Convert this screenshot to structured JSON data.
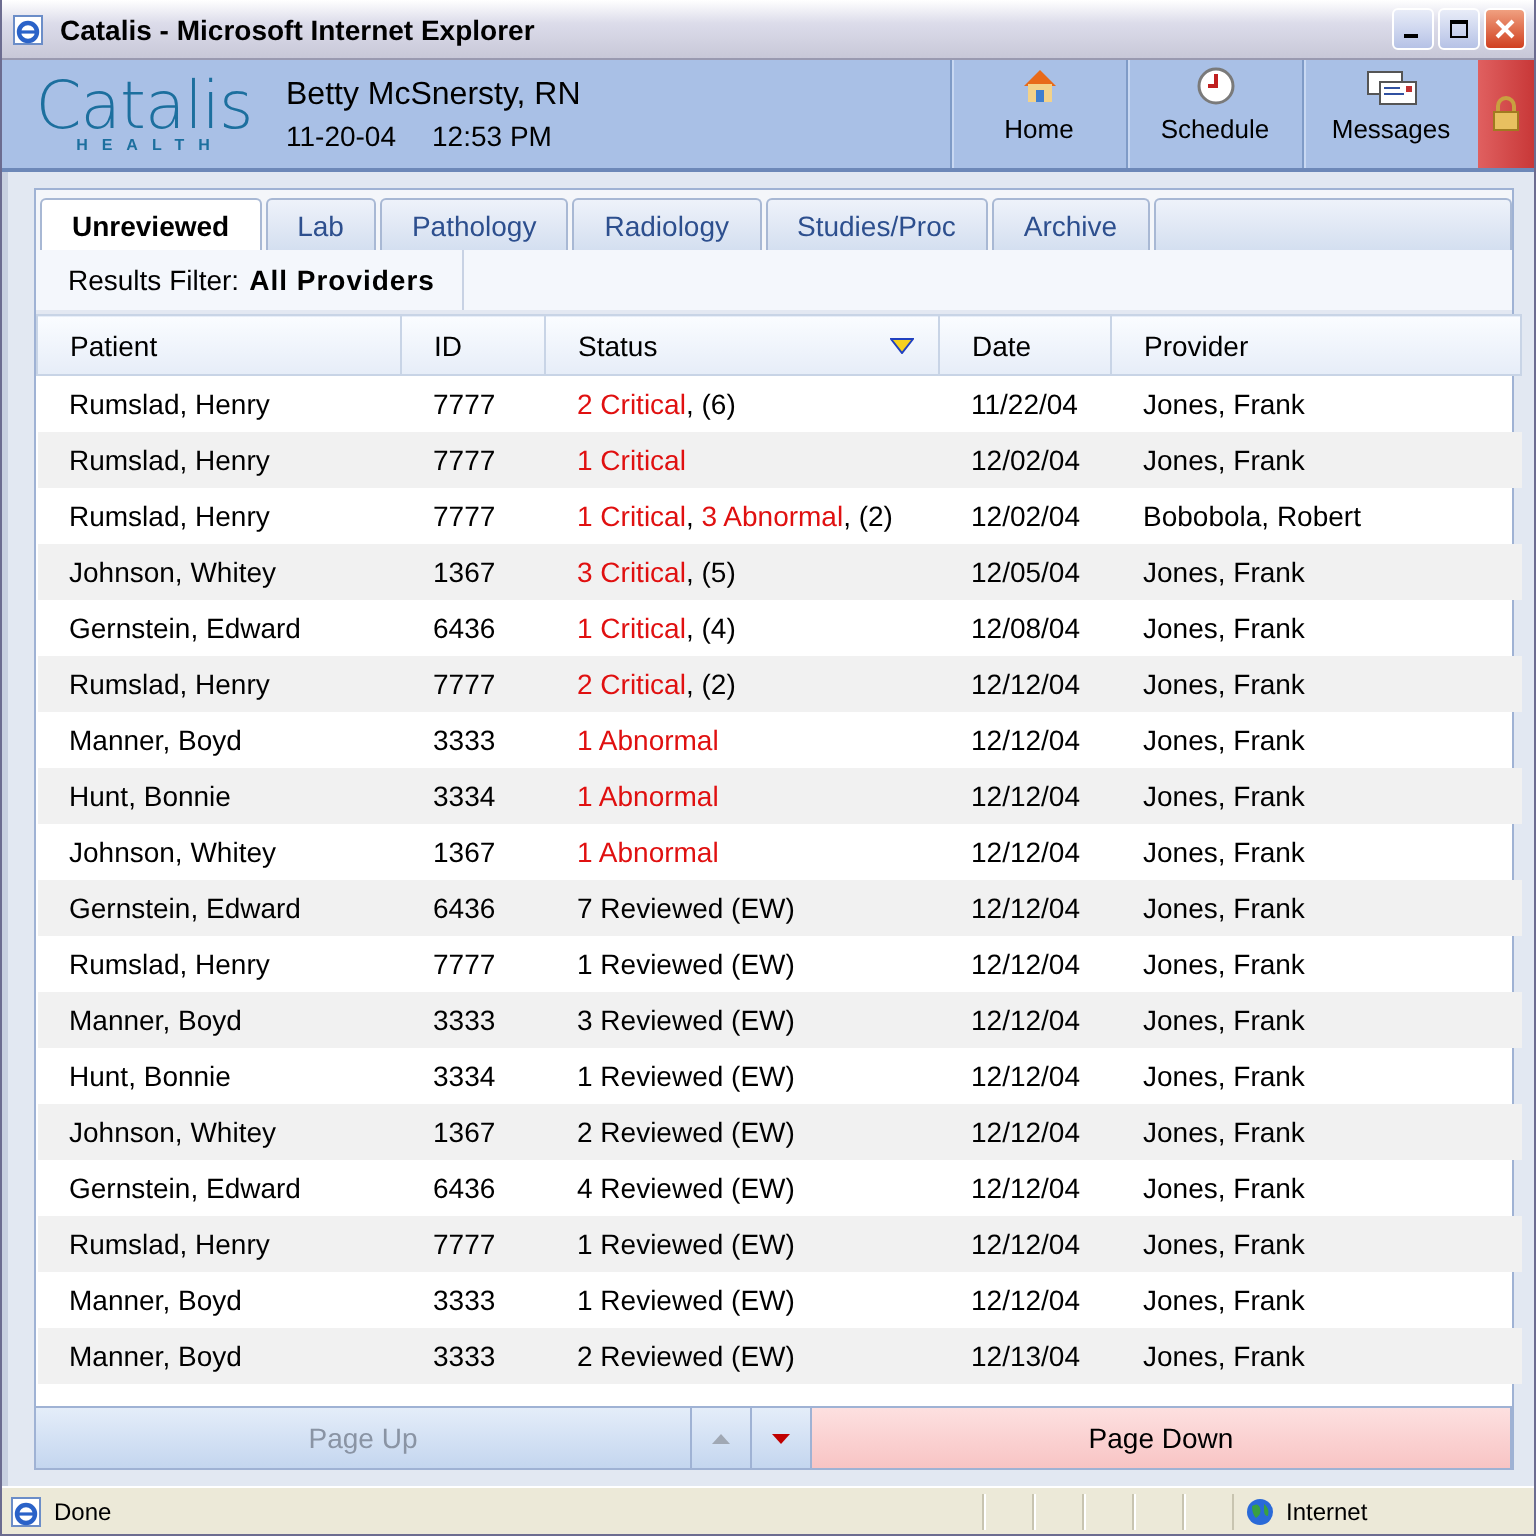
{
  "window": {
    "title": "Catalis - Microsoft Internet Explorer"
  },
  "header": {
    "logo": {
      "name": "Catalis",
      "tagline": "HEALTH"
    },
    "user": "Betty McSnersty, RN",
    "date": "11-20-04",
    "time": "12:53 PM",
    "nav": [
      {
        "kind": "home",
        "label": "Home"
      },
      {
        "kind": "schedule",
        "label": "Schedule"
      },
      {
        "kind": "messages",
        "label": "Messages"
      }
    ]
  },
  "tabs": [
    {
      "label": "Unreviewed",
      "selected": true
    },
    {
      "label": "Lab",
      "selected": false
    },
    {
      "label": "Pathology",
      "selected": false
    },
    {
      "label": "Radiology",
      "selected": false
    },
    {
      "label": "Studies/Proc",
      "selected": false
    },
    {
      "label": "Archive",
      "selected": false
    }
  ],
  "filter": {
    "label": "Results Filter:",
    "value": "All Providers"
  },
  "table": {
    "columns": [
      {
        "label": "Patient",
        "sorted": false
      },
      {
        "label": "ID",
        "sorted": false
      },
      {
        "label": "Status",
        "sorted": true
      },
      {
        "label": "Date",
        "sorted": false
      },
      {
        "label": "Provider",
        "sorted": false
      }
    ],
    "rows": [
      {
        "patient": "Rumslad, Henry",
        "id": "7777",
        "status": [
          {
            "text": "2 Critical",
            "alert": true,
            "after": ", (6)"
          }
        ],
        "date": "11/22/04",
        "provider": "Jones, Frank"
      },
      {
        "patient": "Rumslad, Henry",
        "id": "7777",
        "status": [
          {
            "text": "1 Critical",
            "alert": true
          }
        ],
        "date": "12/02/04",
        "provider": "Jones, Frank"
      },
      {
        "patient": "Rumslad, Henry",
        "id": "7777",
        "status": [
          {
            "text": "1 Critical",
            "alert": true,
            "after": ", "
          },
          {
            "text": "3 Abnormal",
            "alert": true,
            "after": ", (2)"
          }
        ],
        "date": "12/02/04",
        "provider": "Bobobola, Robert"
      },
      {
        "patient": "Johnson, Whitey",
        "id": "1367",
        "status": [
          {
            "text": "3 Critical",
            "alert": true,
            "after": ", (5)"
          }
        ],
        "date": "12/05/04",
        "provider": "Jones, Frank"
      },
      {
        "patient": "Gernstein, Edward",
        "id": "6436",
        "status": [
          {
            "text": "1 Critical",
            "alert": true,
            "after": ", (4)"
          }
        ],
        "date": "12/08/04",
        "provider": "Jones, Frank"
      },
      {
        "patient": "Rumslad, Henry",
        "id": "7777",
        "status": [
          {
            "text": "2 Critical",
            "alert": true,
            "after": ", (2)"
          }
        ],
        "date": "12/12/04",
        "provider": "Jones, Frank"
      },
      {
        "patient": "Manner, Boyd",
        "id": "3333",
        "status": [
          {
            "text": "1 Abnormal",
            "alert": true
          }
        ],
        "date": "12/12/04",
        "provider": "Jones, Frank"
      },
      {
        "patient": "Hunt, Bonnie",
        "id": "3334",
        "status": [
          {
            "text": "1 Abnormal",
            "alert": true
          }
        ],
        "date": "12/12/04",
        "provider": "Jones, Frank"
      },
      {
        "patient": "Johnson, Whitey",
        "id": "1367",
        "status": [
          {
            "text": "1 Abnormal",
            "alert": true
          }
        ],
        "date": "12/12/04",
        "provider": "Jones, Frank"
      },
      {
        "patient": "Gernstein, Edward",
        "id": "6436",
        "status": [
          {
            "text": "7 Reviewed (EW)",
            "alert": false
          }
        ],
        "date": "12/12/04",
        "provider": "Jones, Frank"
      },
      {
        "patient": "Rumslad, Henry",
        "id": "7777",
        "status": [
          {
            "text": "1 Reviewed (EW)",
            "alert": false
          }
        ],
        "date": "12/12/04",
        "provider": "Jones, Frank"
      },
      {
        "patient": "Manner, Boyd",
        "id": "3333",
        "status": [
          {
            "text": "3 Reviewed (EW)",
            "alert": false
          }
        ],
        "date": "12/12/04",
        "provider": "Jones, Frank"
      },
      {
        "patient": "Hunt, Bonnie",
        "id": "3334",
        "status": [
          {
            "text": "1 Reviewed (EW)",
            "alert": false
          }
        ],
        "date": "12/12/04",
        "provider": "Jones, Frank"
      },
      {
        "patient": "Johnson, Whitey",
        "id": "1367",
        "status": [
          {
            "text": "2 Reviewed (EW)",
            "alert": false
          }
        ],
        "date": "12/12/04",
        "provider": "Jones, Frank"
      },
      {
        "patient": "Gernstein, Edward",
        "id": "6436",
        "status": [
          {
            "text": "4 Reviewed (EW)",
            "alert": false
          }
        ],
        "date": "12/12/04",
        "provider": "Jones, Frank"
      },
      {
        "patient": "Rumslad, Henry",
        "id": "7777",
        "status": [
          {
            "text": "1 Reviewed (EW)",
            "alert": false
          }
        ],
        "date": "12/12/04",
        "provider": "Jones, Frank"
      },
      {
        "patient": "Manner, Boyd",
        "id": "3333",
        "status": [
          {
            "text": "1 Reviewed (EW)",
            "alert": false
          }
        ],
        "date": "12/12/04",
        "provider": "Jones, Frank"
      },
      {
        "patient": "Manner, Boyd",
        "id": "3333",
        "status": [
          {
            "text": "2 Reviewed (EW)",
            "alert": false
          }
        ],
        "date": "12/13/04",
        "provider": "Jones, Frank"
      }
    ]
  },
  "pager": {
    "page_up": {
      "label": "Page Up",
      "disabled": true
    },
    "scroll_up": {
      "disabled": true
    },
    "scroll_down": {
      "disabled": false
    },
    "page_down": {
      "label": "Page Down",
      "disabled": false
    }
  },
  "status_bar": {
    "text": "Done",
    "zone": "Internet"
  }
}
